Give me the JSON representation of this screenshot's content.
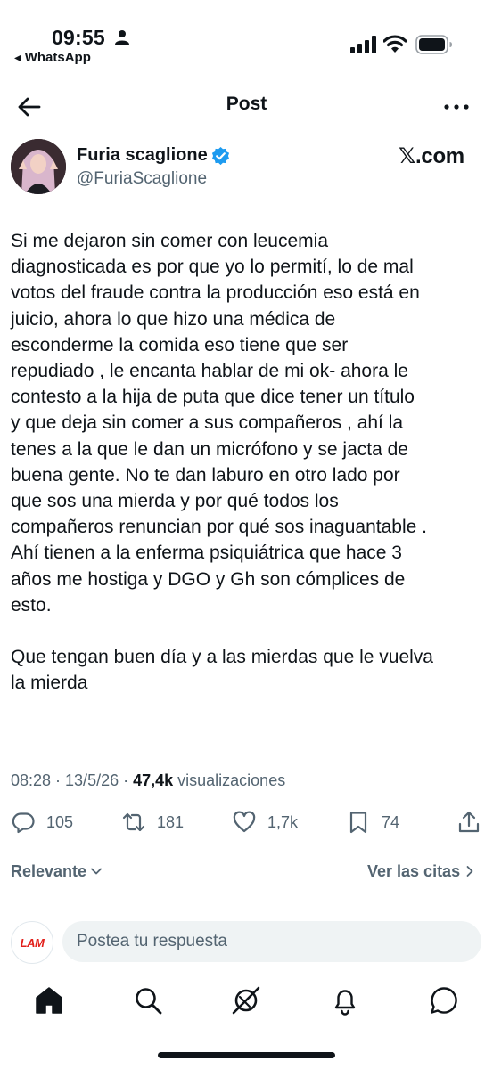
{
  "status_bar": {
    "time": "09:55",
    "back_app": "WhatsApp"
  },
  "header": {
    "title": "Post"
  },
  "author": {
    "name": "Furia scaglione",
    "handle": "@FuriaScaglione",
    "verified_color": "#1d9bf0",
    "source_label": "𝕏.com"
  },
  "tweet": {
    "text": "Si me dejaron sin comer con leucemia\ndiagnosticada es por que yo lo permití, lo de mal\nvotos del fraude contra la producción eso está en\njuicio, ahora lo que hizo una médica de\nesconderme la comida eso tiene que ser\nrepudiado , le encanta hablar de mi ok- ahora le\ncontesto a la hija de puta que dice tener un título\ny que deja sin comer a sus compañeros , ahí la\ntenes a la que le dan un micrófono y se jacta de\nbuena gente. No te dan laburo en otro lado por\nque sos una mierda y por qué todos los\ncompañeros renuncian por qué sos inaguantable .\nAhí tienen a la enferma psiquiátrica que hace 3\naños me hostiga y DGO y Gh son cómplices de\nesto.\n\nQue tengan buen día y a las mierdas que le vuelva\nla mierda",
    "timestamp": "08:28 · 13/5/26 · ",
    "views_count": "47,4k",
    "views_label": " visualizaciones"
  },
  "actions": {
    "replies": "105",
    "reposts": "181",
    "likes": "1,7k",
    "bookmarks": "74"
  },
  "filters": {
    "sort_label": "Relevante",
    "quotes_label": "Ver las citas"
  },
  "reply": {
    "avatar_text": "LAM",
    "placeholder": "Postea tu respuesta"
  },
  "icons": {
    "status": [
      "person-icon",
      "signal-icon",
      "wifi-icon",
      "battery-icon"
    ],
    "header": [
      "back-arrow-icon",
      "more-icon"
    ],
    "actions": [
      "reply-icon",
      "repost-icon",
      "like-icon",
      "bookmark-icon",
      "share-icon"
    ],
    "nav": [
      "home-icon",
      "search-icon",
      "grok-icon",
      "notifications-icon",
      "messages-icon"
    ]
  }
}
